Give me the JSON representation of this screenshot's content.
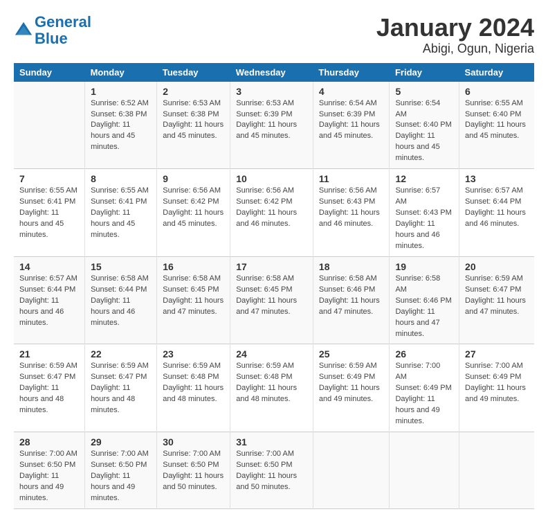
{
  "logo": {
    "line1": "General",
    "line2": "Blue"
  },
  "title": "January 2024",
  "subtitle": "Abigi, Ogun, Nigeria",
  "days_of_week": [
    "Sunday",
    "Monday",
    "Tuesday",
    "Wednesday",
    "Thursday",
    "Friday",
    "Saturday"
  ],
  "weeks": [
    [
      {
        "day": "",
        "sunrise": "",
        "sunset": "",
        "daylight": ""
      },
      {
        "day": "1",
        "sunrise": "Sunrise: 6:52 AM",
        "sunset": "Sunset: 6:38 PM",
        "daylight": "Daylight: 11 hours and 45 minutes."
      },
      {
        "day": "2",
        "sunrise": "Sunrise: 6:53 AM",
        "sunset": "Sunset: 6:38 PM",
        "daylight": "Daylight: 11 hours and 45 minutes."
      },
      {
        "day": "3",
        "sunrise": "Sunrise: 6:53 AM",
        "sunset": "Sunset: 6:39 PM",
        "daylight": "Daylight: 11 hours and 45 minutes."
      },
      {
        "day": "4",
        "sunrise": "Sunrise: 6:54 AM",
        "sunset": "Sunset: 6:39 PM",
        "daylight": "Daylight: 11 hours and 45 minutes."
      },
      {
        "day": "5",
        "sunrise": "Sunrise: 6:54 AM",
        "sunset": "Sunset: 6:40 PM",
        "daylight": "Daylight: 11 hours and 45 minutes."
      },
      {
        "day": "6",
        "sunrise": "Sunrise: 6:55 AM",
        "sunset": "Sunset: 6:40 PM",
        "daylight": "Daylight: 11 hours and 45 minutes."
      }
    ],
    [
      {
        "day": "7",
        "sunrise": "Sunrise: 6:55 AM",
        "sunset": "Sunset: 6:41 PM",
        "daylight": "Daylight: 11 hours and 45 minutes."
      },
      {
        "day": "8",
        "sunrise": "Sunrise: 6:55 AM",
        "sunset": "Sunset: 6:41 PM",
        "daylight": "Daylight: 11 hours and 45 minutes."
      },
      {
        "day": "9",
        "sunrise": "Sunrise: 6:56 AM",
        "sunset": "Sunset: 6:42 PM",
        "daylight": "Daylight: 11 hours and 45 minutes."
      },
      {
        "day": "10",
        "sunrise": "Sunrise: 6:56 AM",
        "sunset": "Sunset: 6:42 PM",
        "daylight": "Daylight: 11 hours and 46 minutes."
      },
      {
        "day": "11",
        "sunrise": "Sunrise: 6:56 AM",
        "sunset": "Sunset: 6:43 PM",
        "daylight": "Daylight: 11 hours and 46 minutes."
      },
      {
        "day": "12",
        "sunrise": "Sunrise: 6:57 AM",
        "sunset": "Sunset: 6:43 PM",
        "daylight": "Daylight: 11 hours and 46 minutes."
      },
      {
        "day": "13",
        "sunrise": "Sunrise: 6:57 AM",
        "sunset": "Sunset: 6:44 PM",
        "daylight": "Daylight: 11 hours and 46 minutes."
      }
    ],
    [
      {
        "day": "14",
        "sunrise": "Sunrise: 6:57 AM",
        "sunset": "Sunset: 6:44 PM",
        "daylight": "Daylight: 11 hours and 46 minutes."
      },
      {
        "day": "15",
        "sunrise": "Sunrise: 6:58 AM",
        "sunset": "Sunset: 6:44 PM",
        "daylight": "Daylight: 11 hours and 46 minutes."
      },
      {
        "day": "16",
        "sunrise": "Sunrise: 6:58 AM",
        "sunset": "Sunset: 6:45 PM",
        "daylight": "Daylight: 11 hours and 47 minutes."
      },
      {
        "day": "17",
        "sunrise": "Sunrise: 6:58 AM",
        "sunset": "Sunset: 6:45 PM",
        "daylight": "Daylight: 11 hours and 47 minutes."
      },
      {
        "day": "18",
        "sunrise": "Sunrise: 6:58 AM",
        "sunset": "Sunset: 6:46 PM",
        "daylight": "Daylight: 11 hours and 47 minutes."
      },
      {
        "day": "19",
        "sunrise": "Sunrise: 6:58 AM",
        "sunset": "Sunset: 6:46 PM",
        "daylight": "Daylight: 11 hours and 47 minutes."
      },
      {
        "day": "20",
        "sunrise": "Sunrise: 6:59 AM",
        "sunset": "Sunset: 6:47 PM",
        "daylight": "Daylight: 11 hours and 47 minutes."
      }
    ],
    [
      {
        "day": "21",
        "sunrise": "Sunrise: 6:59 AM",
        "sunset": "Sunset: 6:47 PM",
        "daylight": "Daylight: 11 hours and 48 minutes."
      },
      {
        "day": "22",
        "sunrise": "Sunrise: 6:59 AM",
        "sunset": "Sunset: 6:47 PM",
        "daylight": "Daylight: 11 hours and 48 minutes."
      },
      {
        "day": "23",
        "sunrise": "Sunrise: 6:59 AM",
        "sunset": "Sunset: 6:48 PM",
        "daylight": "Daylight: 11 hours and 48 minutes."
      },
      {
        "day": "24",
        "sunrise": "Sunrise: 6:59 AM",
        "sunset": "Sunset: 6:48 PM",
        "daylight": "Daylight: 11 hours and 48 minutes."
      },
      {
        "day": "25",
        "sunrise": "Sunrise: 6:59 AM",
        "sunset": "Sunset: 6:49 PM",
        "daylight": "Daylight: 11 hours and 49 minutes."
      },
      {
        "day": "26",
        "sunrise": "Sunrise: 7:00 AM",
        "sunset": "Sunset: 6:49 PM",
        "daylight": "Daylight: 11 hours and 49 minutes."
      },
      {
        "day": "27",
        "sunrise": "Sunrise: 7:00 AM",
        "sunset": "Sunset: 6:49 PM",
        "daylight": "Daylight: 11 hours and 49 minutes."
      }
    ],
    [
      {
        "day": "28",
        "sunrise": "Sunrise: 7:00 AM",
        "sunset": "Sunset: 6:50 PM",
        "daylight": "Daylight: 11 hours and 49 minutes."
      },
      {
        "day": "29",
        "sunrise": "Sunrise: 7:00 AM",
        "sunset": "Sunset: 6:50 PM",
        "daylight": "Daylight: 11 hours and 49 minutes."
      },
      {
        "day": "30",
        "sunrise": "Sunrise: 7:00 AM",
        "sunset": "Sunset: 6:50 PM",
        "daylight": "Daylight: 11 hours and 50 minutes."
      },
      {
        "day": "31",
        "sunrise": "Sunrise: 7:00 AM",
        "sunset": "Sunset: 6:50 PM",
        "daylight": "Daylight: 11 hours and 50 minutes."
      },
      {
        "day": "",
        "sunrise": "",
        "sunset": "",
        "daylight": ""
      },
      {
        "day": "",
        "sunrise": "",
        "sunset": "",
        "daylight": ""
      },
      {
        "day": "",
        "sunrise": "",
        "sunset": "",
        "daylight": ""
      }
    ]
  ]
}
